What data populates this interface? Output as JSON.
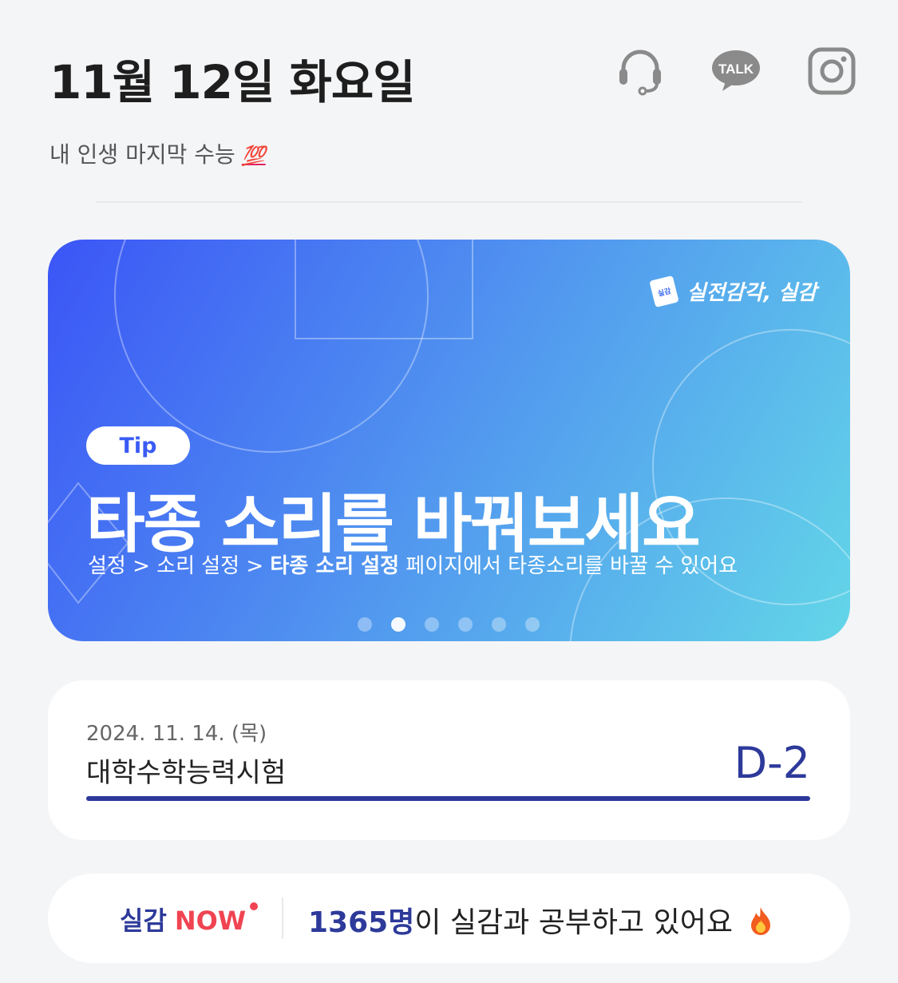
{
  "header": {
    "date": "11월 12일 화요일",
    "icons": [
      "headset-icon",
      "kakaotalk-icon",
      "instagram-icon"
    ],
    "talk_label": "TALK"
  },
  "subtitle": {
    "text": "내 인생 마지막 수능",
    "emoji": "💯"
  },
  "banner": {
    "brand_logo_text": "실감",
    "brand_name": "실전감각, 실감",
    "tag": "Tip",
    "title": "타종 소리를 바꿔보세요",
    "desc_prefix": "설정 > 소리 설정 > ",
    "desc_bold": "타종 소리 설정",
    "desc_suffix": " 페이지에서 타종소리를 바꿀 수 있어요",
    "slide_count": 6,
    "active_slide": 2,
    "colors": {
      "start": "#3b55f6",
      "end": "#63d6e8"
    }
  },
  "exam": {
    "date": "2024. 11. 14. (목)",
    "name": "대학수학능력시험",
    "dday": "D-2",
    "accent": "#2d3a9a"
  },
  "now": {
    "label_main": "실감",
    "label_now": "NOW",
    "count": "1365명",
    "text": "이 실감과 공부하고 있어요",
    "emoji": "🔥"
  }
}
